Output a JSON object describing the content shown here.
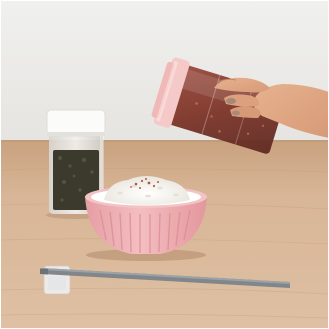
{
  "photo": {
    "subject": "hand-shaking-seasoning-onto-rice",
    "colors": {
      "wall": "#eeeeec",
      "table": "#d7b495",
      "bowl": "#efb0b4",
      "rice": "#f8f6f1",
      "shaker_cap": "#f5c9c7",
      "seasoning": "#8f3c2f",
      "furikake": "#3b3a2c",
      "chopsticks": "#80868b"
    }
  }
}
